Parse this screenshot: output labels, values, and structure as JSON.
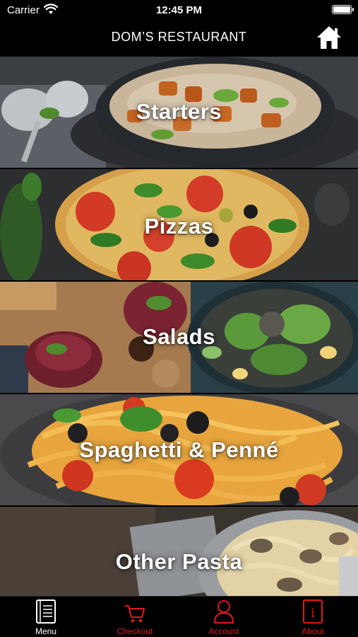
{
  "status": {
    "carrier": "Carrier",
    "time": "12:45 PM"
  },
  "header": {
    "title": "DOM’S RESTAURANT",
    "home_icon": "home-icon"
  },
  "categories": [
    {
      "label": "Starters"
    },
    {
      "label": "Pizzas"
    },
    {
      "label": "Salads"
    },
    {
      "label": "Spaghetti & Penné"
    },
    {
      "label": "Other Pasta"
    }
  ],
  "tabs": [
    {
      "label": "Menu",
      "icon": "menu-book-icon",
      "active": true
    },
    {
      "label": "Checkout",
      "icon": "cart-icon",
      "active": false
    },
    {
      "label": "Account",
      "icon": "person-icon",
      "active": false
    },
    {
      "label": "About",
      "icon": "info-icon",
      "active": false
    }
  ],
  "colors": {
    "background": "#000000",
    "active_tab": "#ffffff",
    "inactive_tab": "#e0191b"
  }
}
